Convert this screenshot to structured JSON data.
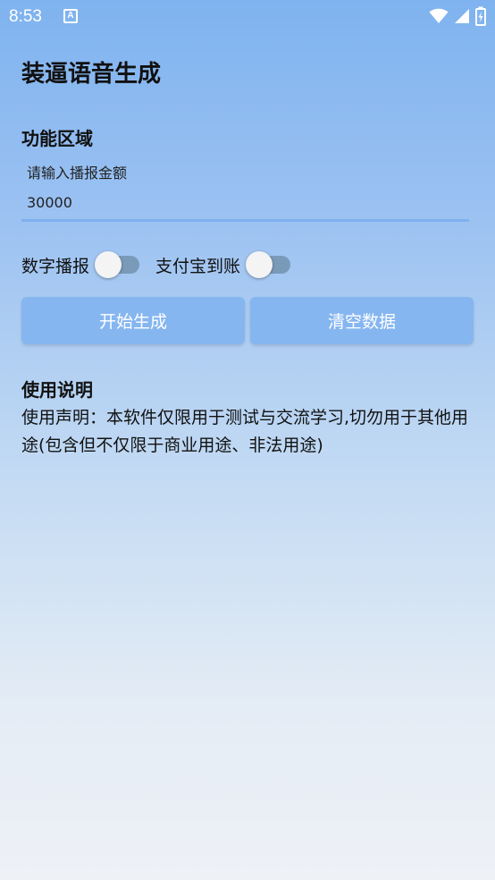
{
  "status_bar": {
    "time": "8:53",
    "app_icon_letter": "A",
    "icons": [
      "wifi-icon",
      "cellular-signal-icon",
      "battery-charging-icon"
    ]
  },
  "app": {
    "title": "装逼语音生成"
  },
  "function_area": {
    "title": "功能区域",
    "amount_label": "请输入播报金额",
    "amount_value": "30000",
    "toggles": [
      {
        "label": "数字播报",
        "on": false
      },
      {
        "label": "支付宝到账",
        "on": false
      }
    ],
    "start_button": "开始生成",
    "clear_button": "清空数据"
  },
  "instructions": {
    "title": "使用说明",
    "text": "使用声明：本软件仅限用于测试与交流学习,切勿用于其他用途(包含但不仅限于商业用途、非法用途)"
  },
  "colors": {
    "button_bg": "#86b6f0",
    "input_underline": "#7fb0ee",
    "switch_track": "#7a9ab9",
    "gradient_top": "#7fb3ef",
    "gradient_bottom": "#eef1f6"
  }
}
